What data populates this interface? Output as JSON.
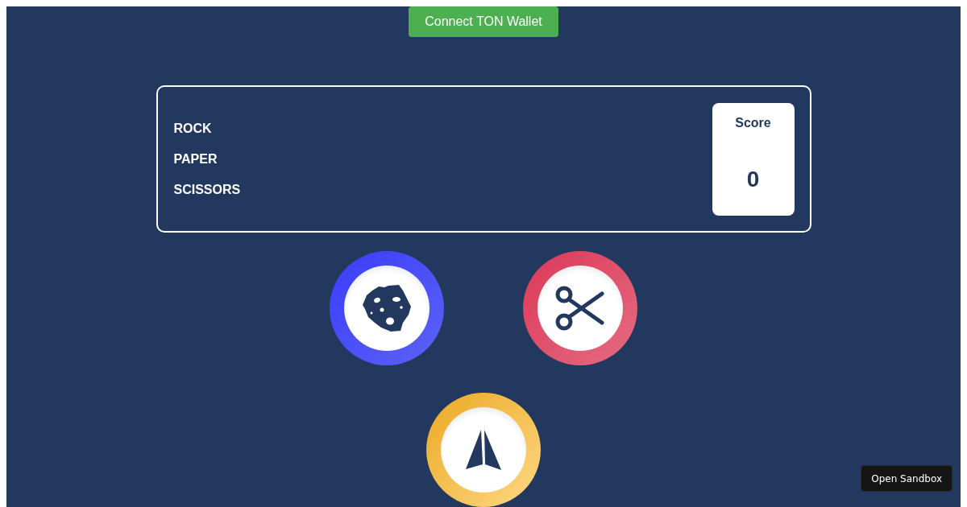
{
  "header": {
    "connect_button": "Connect TON Wallet"
  },
  "scoreboard": {
    "title_lines": [
      "ROCK",
      "PAPER",
      "SCISSORS"
    ],
    "score": {
      "label": "Score",
      "value": "0"
    }
  },
  "choices": [
    {
      "kind": "rock"
    },
    {
      "kind": "scissors"
    },
    {
      "kind": "paper"
    }
  ],
  "sandbox_button": "Open Sandbox"
}
